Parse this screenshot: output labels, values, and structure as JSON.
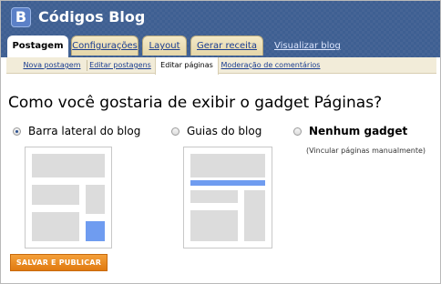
{
  "header": {
    "logo_letter": "B",
    "title": "Códigos Blog"
  },
  "tabs": [
    {
      "label": "Postagem",
      "active": true
    },
    {
      "label": "Configurações",
      "active": false
    },
    {
      "label": "Layout",
      "active": false
    },
    {
      "label": "Gerar receita",
      "active": false
    }
  ],
  "view_blog_link": "Visualizar blog",
  "subtabs": [
    {
      "label": "Nova postagem",
      "active": false
    },
    {
      "label": "Editar postagens",
      "active": false
    },
    {
      "label": "Editar páginas",
      "active": true
    },
    {
      "label": "Moderação de comentários",
      "active": false
    }
  ],
  "question": "Como você gostaria de exibir o gadget Páginas?",
  "options": [
    {
      "label": "Barra lateral do blog",
      "checked": true
    },
    {
      "label": "Guias do blog",
      "checked": false
    },
    {
      "label": "Nenhum gadget",
      "checked": false,
      "note": "(Vincular páginas manualmente)"
    }
  ],
  "publish_button": "SALVAR E PUBLICAR",
  "colors": {
    "header_blue": "#3e5f92",
    "accent_orange": "#e98a20",
    "preview_blue": "#6f9cf0"
  }
}
